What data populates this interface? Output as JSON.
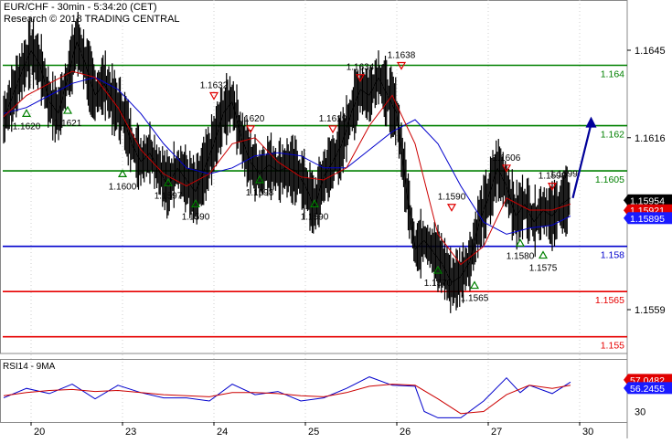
{
  "header": {
    "title": "EUR/CHF - 30min - 5:34:20 (CET)",
    "copyright": "Research © 2018 TRADING CENTRAL"
  },
  "chart_data": [
    {
      "type": "line",
      "name": "price",
      "y_scale": {
        "price_a": 1.1645,
        "price_b": 1.1559
      },
      "ylim": [
        1.1541,
        1.1662
      ],
      "xlim": [
        0,
        17
      ],
      "y_axis_ticks": [
        1.1645,
        1.1616,
        1.1559
      ],
      "x_axis_ticks": [
        {
          "x": 0.2,
          "label": "20"
        },
        {
          "x": 2.2,
          "label": "23"
        },
        {
          "x": 4.2,
          "label": "24"
        },
        {
          "x": 6.2,
          "label": "25"
        },
        {
          "x": 8.2,
          "label": "26"
        },
        {
          "x": 10.2,
          "label": "27"
        },
        {
          "x": 12.2,
          "label": "30"
        }
      ],
      "horizontal_levels": [
        {
          "value": 1.164,
          "label": "1.164",
          "color": "#008000"
        },
        {
          "value": 1.162,
          "label": "1.162",
          "color": "#008000"
        },
        {
          "value": 1.1605,
          "label": "1.1605",
          "color": "#008000"
        },
        {
          "value": 1.158,
          "label": "1.158",
          "color": "#0000cc"
        },
        {
          "value": 1.1565,
          "label": "1.1565",
          "color": "#e60000"
        },
        {
          "value": 1.155,
          "label": "1.155",
          "color": "#e60000"
        }
      ],
      "price_tags": [
        {
          "value": 1.15954,
          "label": "1.15954",
          "color": "#000000"
        },
        {
          "value": 1.15921,
          "label": "1.15921",
          "color": "#e00000"
        },
        {
          "value": 1.15895,
          "label": "1.15895",
          "color": "#1a1aff"
        }
      ],
      "close_series": {
        "name": "Close",
        "color": "#000000",
        "x": [
          0.0,
          0.2,
          0.4,
          0.6,
          0.8,
          1.0,
          1.2,
          1.4,
          1.6,
          1.8,
          2.0,
          2.2,
          2.4,
          2.6,
          2.8,
          3.0,
          3.2,
          3.4,
          3.6,
          3.8,
          4.0,
          4.2,
          4.4,
          4.6,
          4.8,
          5.0,
          5.2,
          5.4,
          5.6,
          5.8,
          6.0,
          6.2,
          6.4,
          6.6,
          6.8,
          7.0,
          7.2,
          7.4,
          7.6,
          7.8,
          8.0,
          8.2,
          8.4,
          8.6,
          8.8,
          9.0,
          9.2,
          9.4,
          9.6,
          9.8,
          10.0,
          10.2,
          10.4,
          10.6,
          10.8,
          11.0,
          11.2,
          11.4,
          11.6,
          11.8,
          12.0,
          12.2,
          12.4
        ],
        "y": [
          1.1622,
          1.163,
          1.1638,
          1.1645,
          1.164,
          1.1628,
          1.1624,
          1.1636,
          1.1648,
          1.164,
          1.163,
          1.1634,
          1.1628,
          1.1624,
          1.1614,
          1.1608,
          1.1611,
          1.1605,
          1.16,
          1.1606,
          1.1602,
          1.1598,
          1.1606,
          1.1614,
          1.1624,
          1.1628,
          1.1616,
          1.1608,
          1.1604,
          1.1607,
          1.1605,
          1.1606,
          1.1605,
          1.16,
          1.1593,
          1.1603,
          1.1608,
          1.1614,
          1.1624,
          1.1632,
          1.163,
          1.1636,
          1.163,
          1.1624,
          1.16,
          1.1579,
          1.1582,
          1.1578,
          1.1574,
          1.1568,
          1.157,
          1.1575,
          1.1588,
          1.1596,
          1.1606,
          1.16,
          1.159,
          1.1594,
          1.1588,
          1.1592,
          1.159,
          1.1594,
          1.1596
        ]
      },
      "ma_fast": {
        "name": "MA fast",
        "color": "#cc0000",
        "x": [
          0.0,
          0.5,
          1.0,
          1.5,
          2.0,
          2.5,
          3.0,
          3.5,
          4.0,
          4.5,
          5.0,
          5.5,
          6.0,
          6.5,
          7.0,
          7.5,
          8.0,
          8.5,
          9.0,
          9.5,
          10.0,
          10.5,
          11.0,
          11.5,
          12.0,
          12.4
        ],
        "y": [
          1.1623,
          1.163,
          1.1634,
          1.1638,
          1.1636,
          1.1626,
          1.1612,
          1.1604,
          1.16,
          1.1604,
          1.1614,
          1.1616,
          1.1608,
          1.1603,
          1.1602,
          1.1606,
          1.162,
          1.163,
          1.1614,
          1.1584,
          1.1574,
          1.158,
          1.1596,
          1.1592,
          1.1592,
          1.1594
        ]
      },
      "ma_slow": {
        "name": "MA slow",
        "color": "#0000cc",
        "x": [
          0.0,
          0.5,
          1.0,
          1.5,
          2.0,
          2.5,
          3.0,
          3.5,
          4.0,
          4.5,
          5.0,
          5.5,
          6.0,
          6.5,
          7.0,
          7.5,
          8.0,
          8.5,
          9.0,
          9.5,
          10.0,
          10.5,
          11.0,
          11.5,
          12.0,
          12.4
        ],
        "y": [
          1.1624,
          1.1626,
          1.163,
          1.1634,
          1.1636,
          1.1632,
          1.1624,
          1.1614,
          1.1606,
          1.1604,
          1.1606,
          1.161,
          1.1611,
          1.161,
          1.1606,
          1.1606,
          1.1612,
          1.1618,
          1.1622,
          1.1614,
          1.16,
          1.1588,
          1.1584,
          1.1586,
          1.1587,
          1.159
        ]
      },
      "projection_arrow": {
        "x1": 12.45,
        "y1": 1.1596,
        "x2": 12.85,
        "y2": 1.1623,
        "color": "#000099"
      },
      "markers": [
        {
          "x": 0.5,
          "y": 1.1624,
          "label": "1.1620",
          "shape": "up-triangle",
          "color": "#008000"
        },
        {
          "x": 1.4,
          "y": 1.1625,
          "label": "1.1621",
          "shape": "up-triangle",
          "color": "#008000"
        },
        {
          "x": 2.6,
          "y": 1.1604,
          "label": "1.1600",
          "shape": "up-triangle",
          "color": "#008000"
        },
        {
          "x": 3.6,
          "y": 1.1601,
          "label": "1.1597",
          "shape": "up-triangle",
          "color": "#008000"
        },
        {
          "x": 4.2,
          "y": 1.1594,
          "label": "1.1590",
          "shape": "up-triangle",
          "color": "#008000"
        },
        {
          "x": 4.6,
          "y": 1.163,
          "label": "1.1632",
          "shape": "down-triangle",
          "color": "#e00000"
        },
        {
          "x": 5.4,
          "y": 1.1619,
          "label": "1.1620",
          "shape": "down-triangle",
          "color": "#e00000"
        },
        {
          "x": 5.6,
          "y": 1.1602,
          "label": "1.1598",
          "shape": "up-triangle",
          "color": "#008000"
        },
        {
          "x": 6.8,
          "y": 1.1594,
          "label": "1.1590",
          "shape": "up-triangle",
          "color": "#008000"
        },
        {
          "x": 7.2,
          "y": 1.1619,
          "label": "1.1619",
          "shape": "down-triangle",
          "color": "#e00000"
        },
        {
          "x": 7.8,
          "y": 1.1636,
          "label": "1.1634",
          "shape": "down-triangle",
          "color": "#e00000"
        },
        {
          "x": 8.7,
          "y": 1.164,
          "label": "1.1638",
          "shape": "down-triangle",
          "color": "#e00000"
        },
        {
          "x": 9.5,
          "y": 1.1572,
          "label": "1.1570",
          "shape": "up-triangle",
          "color": "#008000"
        },
        {
          "x": 9.8,
          "y": 1.1593,
          "label": "1.1590",
          "shape": "down-triangle",
          "color": "#e00000"
        },
        {
          "x": 10.3,
          "y": 1.1567,
          "label": "1.1565",
          "shape": "up-triangle",
          "color": "#008000"
        },
        {
          "x": 11.0,
          "y": 1.1606,
          "label": "1.1606",
          "shape": "down-triangle",
          "color": "#e00000"
        },
        {
          "x": 11.3,
          "y": 1.1581,
          "label": "1.1580",
          "shape": "up-triangle",
          "color": "#008000"
        },
        {
          "x": 11.8,
          "y": 1.1577,
          "label": "1.1575",
          "shape": "up-triangle",
          "color": "#008000"
        },
        {
          "x": 12.0,
          "y": 1.16,
          "label": "1.1598",
          "shape": "down-triangle",
          "color": "#e00000"
        }
      ],
      "extra_labels": [
        {
          "x": 12.25,
          "y": 1.1603,
          "label": "1.1599"
        }
      ]
    },
    {
      "type": "line",
      "name": "rsi",
      "title": "RSI14 - 9MA",
      "ylim": [
        20,
        80
      ],
      "ytick": 30,
      "rsi_tags": [
        {
          "value": 57.0482,
          "label": "57.0482",
          "color": "#e00000"
        },
        {
          "value": 56.2455,
          "label": "56.2455",
          "color": "#1a1aff"
        }
      ],
      "series": [
        {
          "name": "RSI14",
          "color": "#0000cc",
          "x": [
            0.0,
            0.5,
            1.0,
            1.5,
            2.0,
            2.5,
            3.0,
            3.5,
            4.0,
            4.5,
            5.0,
            5.5,
            6.0,
            6.5,
            7.0,
            7.5,
            8.0,
            8.5,
            9.0,
            9.2,
            9.5,
            10.0,
            10.5,
            11.0,
            11.3,
            11.5,
            12.0,
            12.4
          ],
          "y": [
            43,
            52,
            47,
            56,
            42,
            55,
            48,
            43,
            43,
            40,
            56,
            46,
            49,
            40,
            43,
            52,
            63,
            55,
            54,
            30,
            24,
            24,
            40,
            62,
            48,
            55,
            47,
            58
          ]
        },
        {
          "name": "9MA",
          "color": "#cc0000",
          "x": [
            0.0,
            0.5,
            1.0,
            1.5,
            2.0,
            2.5,
            3.0,
            3.5,
            4.0,
            4.5,
            5.0,
            5.5,
            6.0,
            6.5,
            7.0,
            7.5,
            8.0,
            8.5,
            9.0,
            9.5,
            10.0,
            10.5,
            11.0,
            11.5,
            12.0,
            12.4
          ],
          "y": [
            45,
            48,
            50,
            51,
            49,
            50,
            48,
            46,
            45,
            44,
            48,
            48,
            47,
            45,
            44,
            48,
            54,
            56,
            55,
            42,
            28,
            30,
            46,
            55,
            52,
            55
          ]
        }
      ]
    }
  ]
}
